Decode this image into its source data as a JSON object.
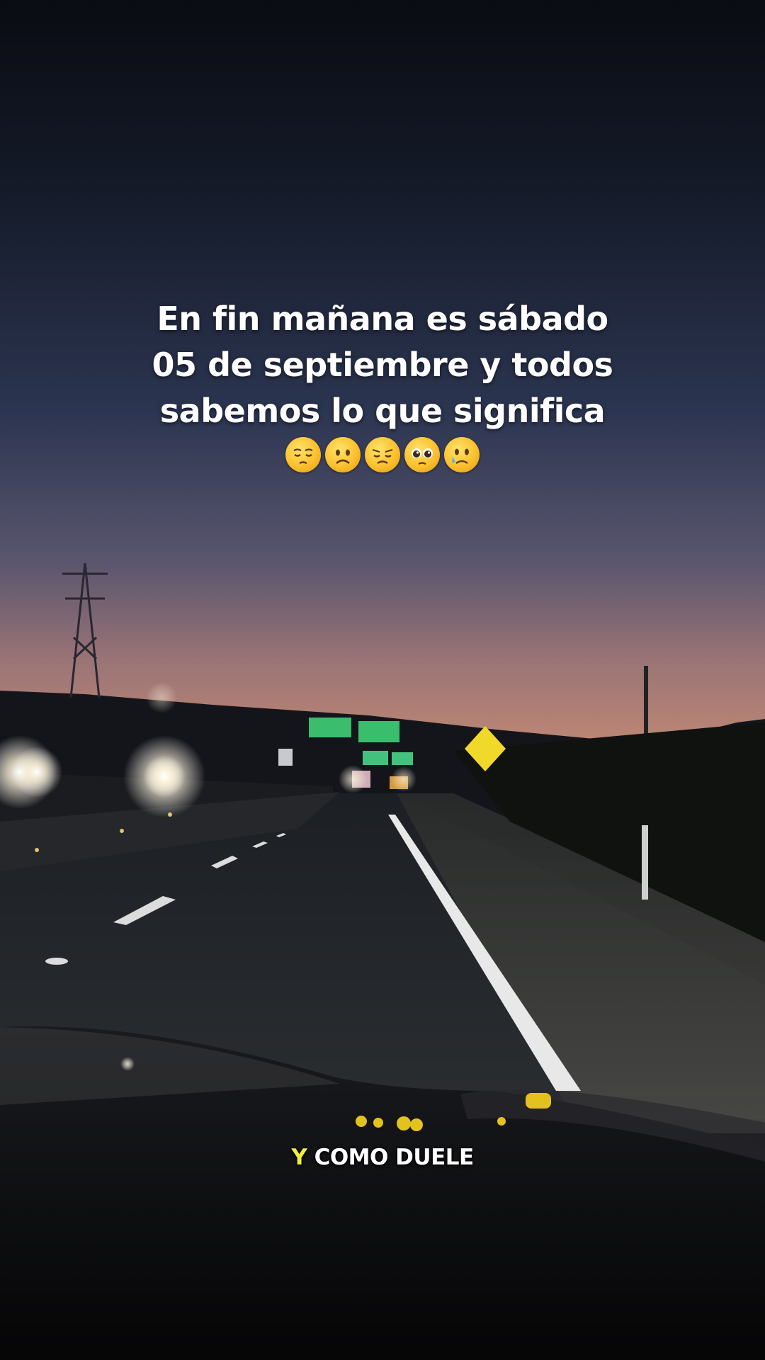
{
  "caption": {
    "lines": [
      "En fin mañana es sábado",
      "05 de septiembre y todos",
      "sabemos lo que significa"
    ],
    "emojis": [
      "pensive-face",
      "frowning-face",
      "disappointed-face",
      "pleading-face",
      "crying-face"
    ]
  },
  "subtitle": {
    "highlight_word": "Y",
    "rest": "COMO DUELE",
    "highlight_color": "#f2ee3a"
  },
  "scene": {
    "description_colors": {
      "sky_top": "#0b0e16",
      "sky_mid": "#2a3350",
      "horizon": "#b98272"
    }
  }
}
